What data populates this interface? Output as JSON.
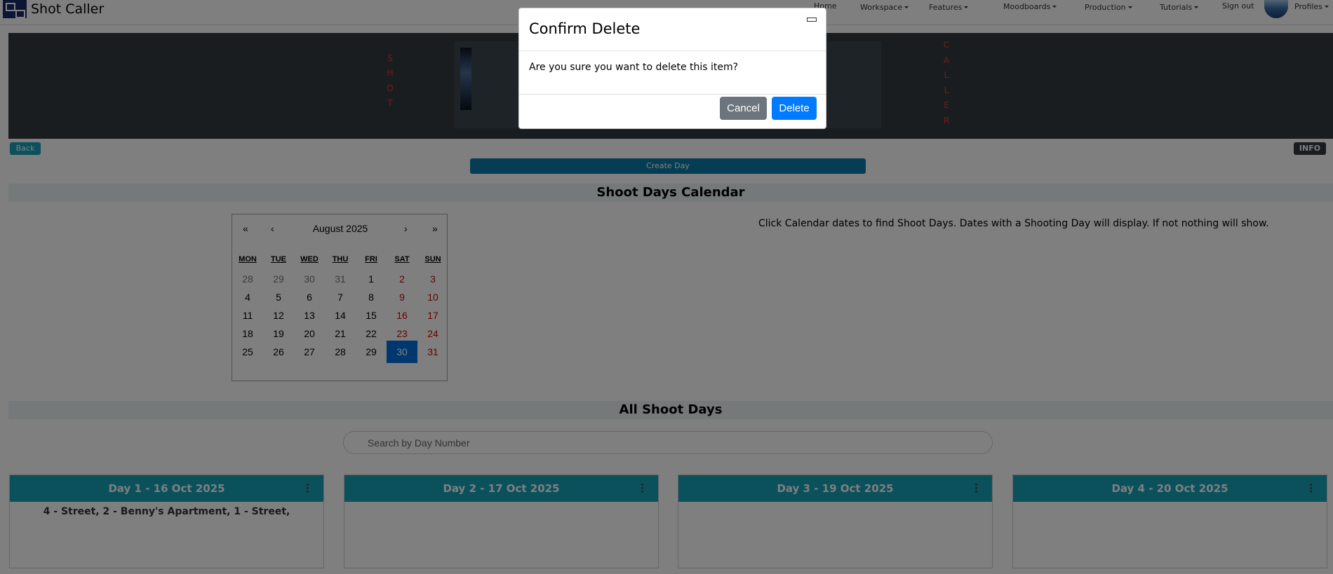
{
  "navbar": {
    "brand": "Shot Caller",
    "items": {
      "home": "Home",
      "workspace": "Workspace",
      "features": "Features",
      "moodboards": "Moodboards",
      "production": "Production",
      "tutorials": "Tutorials",
      "signout": "Sign out",
      "profiles": "Profiles"
    }
  },
  "banner": {
    "left_word": [
      "S",
      "H",
      "O",
      "T"
    ],
    "right_word": [
      "C",
      "A",
      "L",
      "L",
      "E",
      "R"
    ],
    "word_color": "#ee3333"
  },
  "buttons": {
    "back": "Back",
    "info": "INFO",
    "create_day": "Create Day"
  },
  "calendar_section": {
    "title": "Shoot Days Calendar",
    "hint": "Click Calendar dates to find Shoot Days. Dates with a Shooting Day will display. If not nothing will show."
  },
  "calendar": {
    "month_label": "August 2025",
    "nav": {
      "prev_year": "«",
      "prev_month": "‹",
      "next_month": "›",
      "next_year": "»"
    },
    "weekdays": [
      "MON",
      "TUE",
      "WED",
      "THU",
      "FRI",
      "SAT",
      "SUN"
    ],
    "weeks": [
      [
        "28",
        "29",
        "30",
        "31",
        "1",
        "2",
        "3"
      ],
      [
        "4",
        "5",
        "6",
        "7",
        "8",
        "9",
        "10"
      ],
      [
        "11",
        "12",
        "13",
        "14",
        "15",
        "16",
        "17"
      ],
      [
        "18",
        "19",
        "20",
        "21",
        "22",
        "23",
        "24"
      ],
      [
        "25",
        "26",
        "27",
        "28",
        "29",
        "30",
        "31"
      ]
    ],
    "muted_cells": [
      [
        0,
        0
      ],
      [
        0,
        1
      ],
      [
        0,
        2
      ],
      [
        0,
        3
      ]
    ],
    "selected_cell": [
      4,
      5
    ],
    "selected_color": "#006edc",
    "weekend_color": "#d10000"
  },
  "shoot_days_section": {
    "title": "All Shoot Days",
    "search_placeholder": "Search by Day Number"
  },
  "days": [
    {
      "title": "Day 1 - 16 Oct 2025",
      "scenes": "4 - Street, 2 - Benny's Apartment, 1 - Street,"
    },
    {
      "title": "Day 2 - 17 Oct 2025",
      "scenes": ""
    },
    {
      "title": "Day 3 - 19 Oct 2025",
      "scenes": ""
    },
    {
      "title": "Day 4 - 20 Oct 2025",
      "scenes": ""
    }
  ],
  "modal": {
    "title": "Confirm Delete",
    "message": "Are you sure you want to delete this item?",
    "cancel": "Cancel",
    "delete": "Delete"
  },
  "colors": {
    "accent": "#17a2b8",
    "create_button": "#0a7aa8",
    "delete_button": "#007bff",
    "cancel_button": "#6c757d"
  }
}
